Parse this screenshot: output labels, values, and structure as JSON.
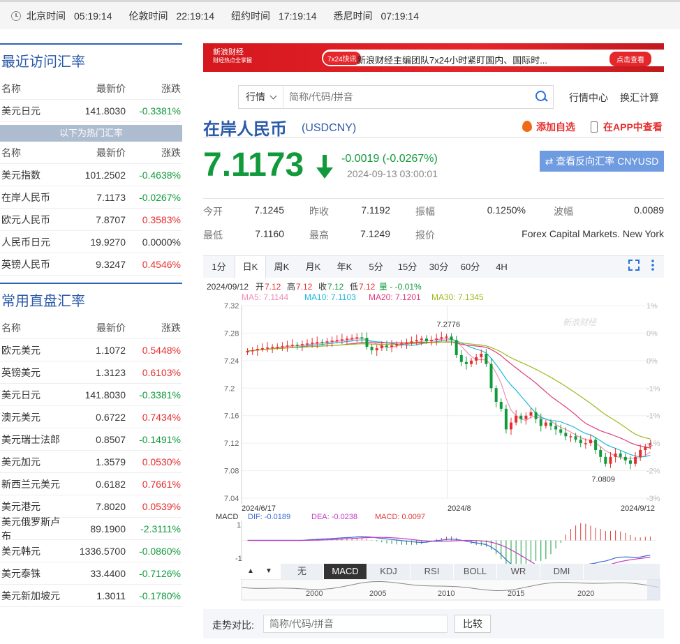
{
  "timebar": [
    {
      "city": "北京时间",
      "time": "05:19:14"
    },
    {
      "city": "伦敦时间",
      "time": "22:19:14"
    },
    {
      "city": "纽约时间",
      "time": "17:19:14"
    },
    {
      "city": "悉尼时间",
      "time": "07:19:14"
    }
  ],
  "recent": {
    "title": "最近访问汇率",
    "headers": [
      "名称",
      "最新价",
      "涨跌"
    ],
    "rows": [
      {
        "name": "美元日元",
        "price": "141.8030",
        "chg": "-0.3381%",
        "dir": "down"
      }
    ],
    "hot_label": "以下为热门汇率"
  },
  "hot": {
    "headers": [
      "名称",
      "最新价",
      "涨跌"
    ],
    "rows": [
      {
        "name": "美元指数",
        "price": "101.2502",
        "chg": "-0.4638%",
        "dir": "down"
      },
      {
        "name": "在岸人民币",
        "price": "7.1173",
        "chg": "-0.0267%",
        "dir": "down"
      },
      {
        "name": "欧元人民币",
        "price": "7.8707",
        "chg": "0.3583%",
        "dir": "up"
      },
      {
        "name": "人民币日元",
        "price": "19.9270",
        "chg": "0.0000%",
        "dir": "flat"
      },
      {
        "name": "英镑人民币",
        "price": "9.3247",
        "chg": "0.4546%",
        "dir": "up"
      }
    ]
  },
  "common": {
    "title": "常用直盘汇率",
    "headers": [
      "名称",
      "最新价",
      "涨跌"
    ],
    "rows": [
      {
        "name": "欧元美元",
        "price": "1.1072",
        "chg": "0.5448%",
        "dir": "up"
      },
      {
        "name": "英镑美元",
        "price": "1.3123",
        "chg": "0.6103%",
        "dir": "up"
      },
      {
        "name": "美元日元",
        "price": "141.8030",
        "chg": "-0.3381%",
        "dir": "down"
      },
      {
        "name": "澳元美元",
        "price": "0.6722",
        "chg": "0.7434%",
        "dir": "up"
      },
      {
        "name": "美元瑞士法郎",
        "price": "0.8507",
        "chg": "-0.1491%",
        "dir": "down"
      },
      {
        "name": "美元加元",
        "price": "1.3579",
        "chg": "0.0530%",
        "dir": "up"
      },
      {
        "name": "新西兰元美元",
        "price": "0.6182",
        "chg": "0.7661%",
        "dir": "up"
      },
      {
        "name": "美元港元",
        "price": "7.8020",
        "chg": "0.0539%",
        "dir": "up"
      },
      {
        "name": "美元俄罗斯卢布",
        "price": "89.1900",
        "chg": "-2.3111%",
        "dir": "down"
      },
      {
        "name": "美元韩元",
        "price": "1336.5700",
        "chg": "-0.0860%",
        "dir": "down"
      },
      {
        "name": "美元泰铢",
        "price": "33.4400",
        "chg": "-0.7126%",
        "dir": "down"
      },
      {
        "name": "美元新加坡元",
        "price": "1.3011",
        "chg": "-0.1780%",
        "dir": "down"
      }
    ]
  },
  "banner": {
    "logo_line1": "新浪财经",
    "logo_line2": "财经热点全掌握",
    "tag": "7x24快讯",
    "text": "新浪财经主编团队7x24小时紧盯国内、国际时...",
    "cta": "点击查看"
  },
  "search": {
    "select_label": "行情",
    "placeholder": "简称/代码/拼音",
    "link1": "行情中心",
    "link2": "换汇计算"
  },
  "quote": {
    "name": "在岸人民币",
    "code": "(USDCNY)",
    "fav_label": "添加自选",
    "app_label": "在APP中查看",
    "price": "7.1173",
    "change": "-0.0019 (-0.0267%)",
    "timestamp": "2024-09-13 03:00:01",
    "reverse_label": "⇄ 查看反向汇率 CNYUSD",
    "colors": {
      "down": "#119a3b",
      "up": "#e62e2e",
      "accent": "#2b5aa8"
    }
  },
  "stats": [
    [
      {
        "label": "今开",
        "value": "7.1245"
      },
      {
        "label": "昨收",
        "value": "7.1192"
      },
      {
        "label": "振幅",
        "value": "0.1250%"
      },
      {
        "label": "波幅",
        "value": "0.0089"
      }
    ],
    [
      {
        "label": "最低",
        "value": "7.1160"
      },
      {
        "label": "最高",
        "value": "7.1249"
      },
      {
        "label": "报价",
        "value": "Forex Capital Markets. New York"
      }
    ]
  ],
  "chart_tabs": [
    "1分",
    "日K",
    "周K",
    "月K",
    "年K",
    "5分",
    "15分",
    "30分",
    "60分",
    "4H"
  ],
  "chart_tab_active": 1,
  "bottom_tabs": [
    "无",
    "MACD",
    "KDJ",
    "RSI",
    "BOLL",
    "WR",
    "DMI"
  ],
  "bottom_tab_active": 1,
  "compare": {
    "label": "走势对比:",
    "placeholder": "简称/代码/拼音",
    "button": "比较"
  },
  "chart_data": {
    "type": "candlestick",
    "info_line": {
      "date": "2024/09/12",
      "items": [
        {
          "label": "开",
          "value": "7.12"
        },
        {
          "label": "高",
          "value": "7.12"
        },
        {
          "label": "收",
          "value": "7.12"
        },
        {
          "label": "低",
          "value": "7.12"
        }
      ],
      "tail": "量 - -0.01%"
    },
    "ma_legend": [
      {
        "name": "MA5",
        "value": "7.1144",
        "color": "#f08fb6"
      },
      {
        "name": "MA10",
        "value": "7.1103",
        "color": "#1fb8d8"
      },
      {
        "name": "MA20",
        "value": "7.1201",
        "color": "#e0397a"
      },
      {
        "name": "MA30",
        "value": "7.1345",
        "color": "#a0b820"
      }
    ],
    "ylim": [
      7.04,
      7.32
    ],
    "y_ticks": [
      "7.32",
      "7.28",
      "7.24",
      "7.2",
      "7.16",
      "7.12",
      "7.08",
      "7.04"
    ],
    "pct_ticks": [
      "1%",
      "0%",
      "0%",
      "-1%",
      "-1%",
      "-1%",
      "-2%",
      "-3%"
    ],
    "x_labels": [
      "2024/6/17",
      "2024/8",
      "2024/9/12"
    ],
    "annotations": [
      {
        "label": "7.2776"
      },
      {
        "label": "7.0809"
      }
    ],
    "watermark": "新浪财经",
    "candles_close": [
      7.254,
      7.255,
      7.257,
      7.258,
      7.259,
      7.26,
      7.26,
      7.261,
      7.262,
      7.263,
      7.262,
      7.264,
      7.265,
      7.266,
      7.267,
      7.266,
      7.268,
      7.269,
      7.27,
      7.271,
      7.272,
      7.273,
      7.274,
      7.273,
      7.26,
      7.255,
      7.258,
      7.262,
      7.26,
      7.262,
      7.264,
      7.265,
      7.266,
      7.268,
      7.27,
      7.272,
      7.268,
      7.27,
      7.272,
      7.274,
      7.275,
      7.27,
      7.248,
      7.238,
      7.235,
      7.24,
      7.245,
      7.25,
      7.235,
      7.2,
      7.18,
      7.17,
      7.14,
      7.15,
      7.16,
      7.155,
      7.16,
      7.165,
      7.155,
      7.145,
      7.15,
      7.145,
      7.14,
      7.135,
      7.13,
      7.13,
      7.125,
      7.12,
      7.12,
      7.125,
      7.11,
      7.1,
      7.09,
      7.1,
      7.105,
      7.1,
      7.095,
      7.09,
      7.1,
      7.11,
      7.115,
      7.12
    ],
    "macd": {
      "label": "MACD",
      "dif": "-0.0189",
      "dea": "-0.0238",
      "macd": "0.0097",
      "y_ticks": [
        "1",
        "-1"
      ],
      "dif_color": "#3a6ad6",
      "dea_color": "#c33ac3",
      "macd_color": "#e03939"
    },
    "navigator_years": [
      "2000",
      "2005",
      "2010",
      "2015",
      "2020"
    ]
  }
}
